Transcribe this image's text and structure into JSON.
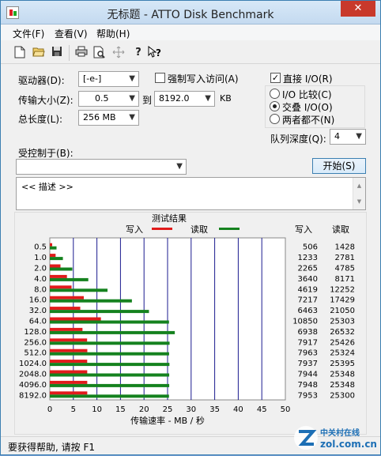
{
  "window": {
    "title": "无标题 - ATTO Disk Benchmark",
    "close": "✕"
  },
  "menu": [
    "文件(F)",
    "查看(V)",
    "帮助(H)"
  ],
  "toolbar": [
    "new-file-icon",
    "open-folder-icon",
    "save-disk-icon",
    "print-icon",
    "print-preview-icon",
    "move-icon",
    "help-icon",
    "context-help-icon"
  ],
  "settings": {
    "drive_label": "驱动器(D):",
    "drive_value": "[-e-]",
    "transfer_label": "传输大小(Z):",
    "transfer_from": "0.5",
    "transfer_to_label": "到",
    "transfer_to": "8192.0",
    "transfer_unit": "KB",
    "total_label": "总长度(L):",
    "total_value": "256 MB",
    "force_write_label": "强制写入访问(A)",
    "force_write_checked": false,
    "direct_io_label": "直接 I/O(R)",
    "direct_io_checked": true,
    "io_compare_label": "I/O 比较(C)",
    "overlapped_io_label": "交叠 I/O(O)",
    "neither_label": "两者都不(N)",
    "queue_label": "队列深度(Q):",
    "queue_value": "4",
    "controlled_label": "受控制于(B):",
    "controlled_value": "",
    "start_label": "开始(S)",
    "description": "<< 描述 >>"
  },
  "chart_data": {
    "type": "bar",
    "title": "测试结果",
    "legend": [
      "写入",
      "读取"
    ],
    "colors": {
      "write": "#e11b1b",
      "read": "#15821f"
    },
    "xlabel": "传输速率 - MB / 秒",
    "xlim": [
      0,
      50
    ],
    "xticks": [
      0,
      5,
      10,
      15,
      20,
      25,
      30,
      35,
      40,
      45,
      50
    ],
    "categories": [
      "0.5",
      "1.0",
      "2.0",
      "4.0",
      "8.0",
      "16.0",
      "32.0",
      "64.0",
      "128.0",
      "256.0",
      "512.0",
      "1024.0",
      "2048.0",
      "4096.0",
      "8192.0"
    ],
    "series": [
      {
        "name": "写入",
        "values": [
          0.506,
          1.233,
          2.265,
          3.64,
          4.619,
          7.217,
          6.463,
          10.85,
          6.938,
          7.917,
          7.963,
          7.937,
          7.944,
          7.948,
          7.953
        ]
      },
      {
        "name": "读取",
        "values": [
          1.428,
          2.781,
          4.785,
          8.171,
          12.252,
          17.429,
          21.05,
          25.303,
          26.532,
          25.426,
          25.324,
          25.395,
          25.348,
          25.348,
          25.3
        ]
      }
    ],
    "table_headers": [
      "写入",
      "读取"
    ],
    "write_values": [
      "506",
      "1233",
      "2265",
      "3640",
      "4619",
      "7217",
      "6463",
      "10850",
      "6938",
      "7917",
      "7963",
      "7937",
      "7944",
      "7948",
      "7953"
    ],
    "read_values": [
      "1428",
      "2781",
      "4785",
      "8171",
      "12252",
      "17429",
      "21050",
      "25303",
      "26532",
      "25426",
      "25324",
      "25395",
      "25348",
      "25348",
      "25300"
    ]
  },
  "status": "要获得帮助, 请按 F1",
  "watermark": {
    "brand": "中关村在线",
    "url": "zol.com.cn"
  }
}
